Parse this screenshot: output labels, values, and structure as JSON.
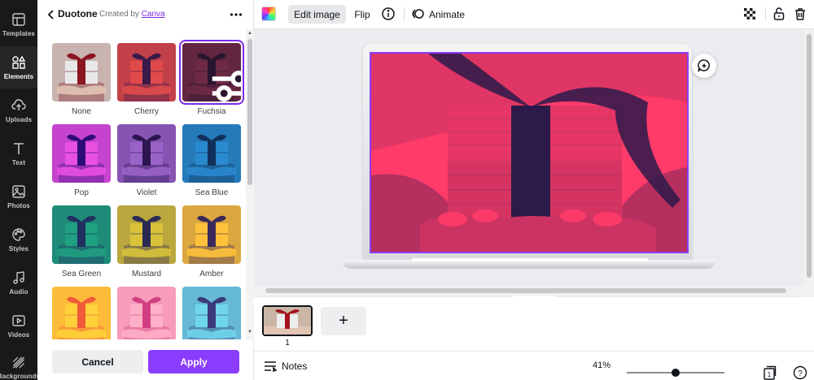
{
  "rail": {
    "items": [
      {
        "label": "Templates"
      },
      {
        "label": "Elements"
      },
      {
        "label": "Uploads"
      },
      {
        "label": "Text"
      },
      {
        "label": "Photos"
      },
      {
        "label": "Styles"
      },
      {
        "label": "Audio"
      },
      {
        "label": "Videos"
      },
      {
        "label": "Backgrounds"
      }
    ],
    "active": "Elements"
  },
  "panel": {
    "title": "Duotone",
    "created_by_prefix": "Created by",
    "created_by_link": "Canva",
    "filters": [
      {
        "label": "None",
        "dark": "#7a1620",
        "light": "#f2f2f2",
        "mode": "none"
      },
      {
        "label": "Cherry",
        "dark": "#3a1a4a",
        "light": "#e14a4a",
        "mode": "duo"
      },
      {
        "label": "Fuchsia",
        "dark": "#2a1530",
        "light": "#6e2a45",
        "mode": "duo",
        "selected": true
      },
      {
        "label": "Pop",
        "dark": "#2e0d7a",
        "light": "#e850e0",
        "mode": "duo"
      },
      {
        "label": "Violet",
        "dark": "#2c1550",
        "light": "#9a63c8",
        "mode": "duo"
      },
      {
        "label": "Sea Blue",
        "dark": "#12305a",
        "light": "#2a8ad0",
        "mode": "duo"
      },
      {
        "label": "Sea Green",
        "dark": "#203060",
        "light": "#1fa080",
        "mode": "duo"
      },
      {
        "label": "Mustard",
        "dark": "#2a2a55",
        "light": "#d9c23a",
        "mode": "duo"
      },
      {
        "label": "Amber",
        "dark": "#3a2a5a",
        "light": "#ffc23a",
        "mode": "duo"
      },
      {
        "label": "",
        "dark": "#f05a3a",
        "light": "#ffd23a",
        "mode": "duo"
      },
      {
        "label": "",
        "dark": "#d04080",
        "light": "#ffb0c8",
        "mode": "duo"
      },
      {
        "label": "",
        "dark": "#3a3a7a",
        "light": "#70d6ea",
        "mode": "duo"
      }
    ],
    "cancel_label": "Cancel",
    "apply_label": "Apply"
  },
  "toolbar": {
    "edit_image_label": "Edit image",
    "flip_label": "Flip",
    "animate_label": "Animate"
  },
  "canvas": {
    "duotone": {
      "dark": "#2b1a4a",
      "light": "#ff3b6a"
    }
  },
  "pages": {
    "items": [
      {
        "number": "1"
      }
    ]
  },
  "bottombar": {
    "notes_label": "Notes",
    "zoom_value": "41%",
    "zoom_fraction": 0.41,
    "page_count": "1",
    "help_label": "?"
  }
}
